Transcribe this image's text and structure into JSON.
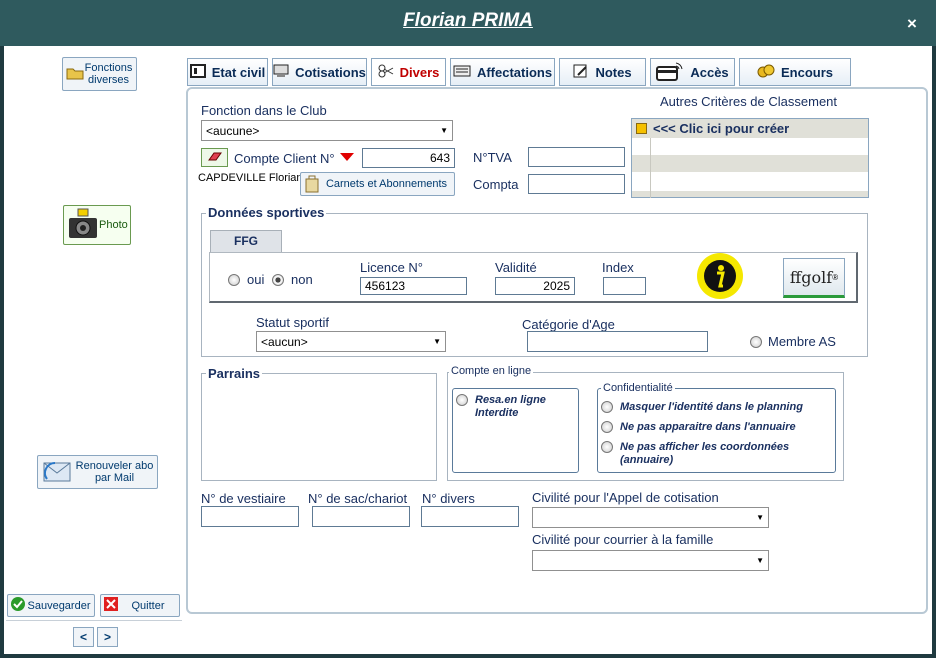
{
  "window": {
    "title": "Florian PRIMA",
    "close_label": "×"
  },
  "sidebar": {
    "fonctions_diverses": "Fonctions diverses",
    "photo": "Photo",
    "renouveler": "Renouveler abo par Mail",
    "sauvegarder": "Sauvegarder",
    "quitter": "Quitter",
    "prev": "<",
    "next": ">"
  },
  "tabs": [
    {
      "label": "Etat civil"
    },
    {
      "label": "Cotisations"
    },
    {
      "label": "Divers"
    },
    {
      "label": "Affectations"
    },
    {
      "label": "Notes"
    },
    {
      "label": "Accès"
    },
    {
      "label": "Encours"
    }
  ],
  "form": {
    "fonction_label": "Fonction dans le Club",
    "fonction_value": "<aucune>",
    "compte_client_label": "Compte Client N°",
    "compte_client_value": "643",
    "client_name": "CAPDEVILLE Florian",
    "carnets_button": "Carnets et Abonnements",
    "ntva_label": "N°TVA",
    "ntva_value": "",
    "compta_label": "Compta",
    "compta_value": "",
    "autres_criteres_label": "Autres Critères de Classement",
    "criteres_create": "<<< Clic ici pour créer"
  },
  "sport": {
    "title": "Données sportives",
    "ffg_tab": "FFG",
    "oui": "oui",
    "non": "non",
    "licence_label": "Licence N°",
    "licence_value": "456123",
    "validite_label": "Validité",
    "validite_value": "2025",
    "index_label": "Index",
    "index_value": "",
    "ffgolf_logo": "ffgolf",
    "statut_label": "Statut sportif",
    "statut_value": "<aucun>",
    "categorie_label": "Catégorie d'Age",
    "categorie_value": "",
    "membre_as": "Membre AS"
  },
  "parrains": {
    "title": "Parrains"
  },
  "compte_en_ligne": {
    "title": "Compte en ligne",
    "resa": "Resa.en ligne Interdite",
    "confidentialite": "Confidentialité",
    "masquer": "Masquer l'identité dans le planning",
    "annuaire": "Ne pas apparaitre dans l'annuaire",
    "coordonnees": "Ne pas afficher les coordonnées (annuaire)"
  },
  "bottom": {
    "vestiaire_label": "N° de vestiaire",
    "sac_label": "N° de sac/chariot",
    "divers_label": "N° divers",
    "civilite_appel_label": "Civilité pour l'Appel de cotisation",
    "civilite_courrier_label": "Civilité pour courrier à la famille"
  },
  "colors": {
    "titlebar": "#2f5a5e",
    "active_tab": "#c00000",
    "label": "#1a3060"
  }
}
